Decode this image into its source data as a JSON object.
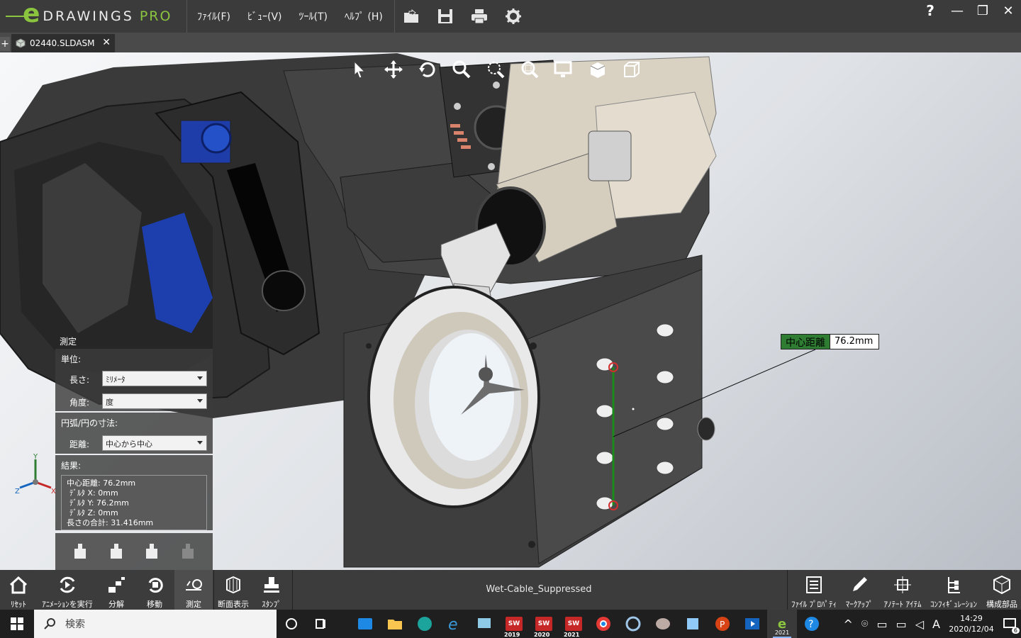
{
  "app": {
    "brand_e": "e",
    "brand": "DRAWINGS",
    "brand_suffix": "PRO"
  },
  "menu": [
    {
      "label": "ﾌｧｲﾙ(F)"
    },
    {
      "label": "ﾋﾞｭｰ(V)"
    },
    {
      "label": "ﾂｰﾙ(T)"
    },
    {
      "label": "ﾍﾙﾌﾟ (H)"
    }
  ],
  "quick_icons": [
    "open-icon",
    "save-icon",
    "print-icon",
    "gear-icon"
  ],
  "window": {
    "help": "?",
    "minimize": "—",
    "restore": "❐",
    "close": "✕"
  },
  "tabs": {
    "new": "+",
    "document": "02440.SLDASM",
    "close": "✕"
  },
  "view_tools": [
    "select-icon",
    "pan-icon",
    "rotate-icon",
    "zoom-icon",
    "zoom-area-icon",
    "zoom-fit-icon",
    "display-style-icon",
    "section-view-icon",
    "view-orientation-icon"
  ],
  "dimension": {
    "label": "中心距離",
    "value": "76.2mm"
  },
  "measure": {
    "title": "測定",
    "units_label": "単位:",
    "length_label": "長さ:",
    "length_value": "ﾐﾘﾒｰﾀ",
    "angle_label": "角度:",
    "angle_value": "度",
    "arc_label": "円弧/円の寸法:",
    "distance_label": "距離:",
    "distance_value": "中心から中心",
    "result_label": "結果:",
    "results": [
      "中心距離: 76.2mm",
      "ﾃﾞﾙﾀ X: 0mm",
      "ﾃﾞﾙﾀ Y: 76.2mm",
      "ﾃﾞﾙﾀ Z: 0mm",
      "長さの合計: 31.416mm"
    ]
  },
  "triad": {
    "x": "X",
    "y": "Y",
    "z": "Z"
  },
  "bottom_tools": [
    {
      "label": "ﾘｾｯﾄ",
      "icon": "home-icon"
    },
    {
      "label": "ｱﾆﾒｰｼｮﾝを実行",
      "icon": "animation-icon"
    },
    {
      "label": "分解",
      "icon": "explode-icon"
    },
    {
      "label": "移動",
      "icon": "move-icon"
    },
    {
      "label": "測定",
      "icon": "measure-icon"
    },
    {
      "label": "断面表示",
      "icon": "section-icon"
    },
    {
      "label": "ｽﾀﾝﾌﾟ",
      "icon": "stamp-icon"
    }
  ],
  "configuration": "Wet-Cable_Suppressed",
  "right_tools": [
    {
      "label": "ﾌｧｲﾙ ﾌﾟﾛﾊﾟﾃｨ",
      "icon": "file-properties-icon"
    },
    {
      "label": "ﾏｰｸｱｯﾌﾟ",
      "icon": "markup-icon"
    },
    {
      "label": "ｱﾉﾃｰﾄ ｱｲﾃﾑ",
      "icon": "annotation-icon"
    },
    {
      "label": "ｺﾝﾌｨｷﾞｭﾚｰｼｮﾝ",
      "icon": "configuration-icon"
    },
    {
      "label": "構成部品",
      "icon": "components-icon"
    }
  ],
  "taskbar": {
    "search_placeholder": "検索",
    "sw_years": [
      "2019",
      "2020",
      "2021"
    ],
    "edrawings_year": "2021",
    "time": "14:29",
    "date": "2020/12/04",
    "ime": "A",
    "notification_count": "6"
  },
  "colors": {
    "accent_green": "#8bc53f",
    "dimension_green": "#2e7d32",
    "measure_line": "#1b8a1b",
    "point_red": "#d32f2f"
  }
}
